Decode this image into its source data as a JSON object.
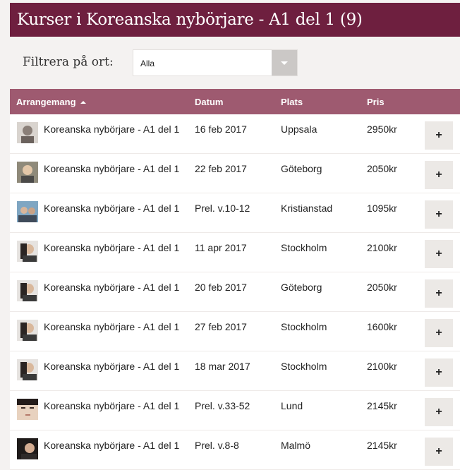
{
  "header": {
    "title": "Kurser i Koreanska nybörjare - A1 del 1 (9)"
  },
  "filter": {
    "label": "Filtrera på ort:",
    "selected": "Alla"
  },
  "table": {
    "columns": [
      "Arrangemang",
      "Datum",
      "Plats",
      "Pris"
    ],
    "add_label": "+",
    "rows": [
      {
        "name": "Koreanska nybörjare - A1 del 1",
        "date": "16 feb 2017",
        "place": "Uppsala",
        "price": "2950kr"
      },
      {
        "name": "Koreanska nybörjare - A1 del 1",
        "date": "22 feb 2017",
        "place": "Göteborg",
        "price": "2050kr"
      },
      {
        "name": "Koreanska nybörjare - A1 del 1",
        "date": "Prel. v.10-12",
        "place": "Kristianstad",
        "price": "1095kr"
      },
      {
        "name": "Koreanska nybörjare - A1 del 1",
        "date": "11 apr 2017",
        "place": "Stockholm",
        "price": "2100kr"
      },
      {
        "name": "Koreanska nybörjare - A1 del 1",
        "date": "20 feb 2017",
        "place": "Göteborg",
        "price": "2050kr"
      },
      {
        "name": "Koreanska nybörjare - A1 del 1",
        "date": "27 feb 2017",
        "place": "Stockholm",
        "price": "1600kr"
      },
      {
        "name": "Koreanska nybörjare - A1 del 1",
        "date": "18 mar 2017",
        "place": "Stockholm",
        "price": "2100kr"
      },
      {
        "name": "Koreanska nybörjare - A1 del 1",
        "date": "Prel. v.33-52",
        "place": "Lund",
        "price": "2145kr"
      },
      {
        "name": "Koreanska nybörjare - A1 del 1",
        "date": "Prel. v.8-8",
        "place": "Malmö",
        "price": "2145kr"
      }
    ]
  }
}
